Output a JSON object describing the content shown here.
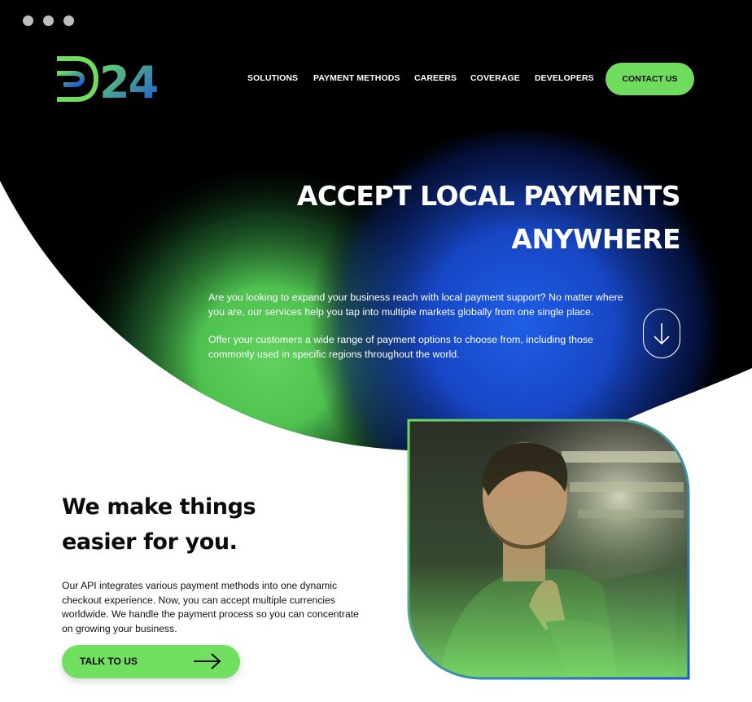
{
  "brand": {
    "logo_text": "D24",
    "colors": {
      "green": "#6fdc5e",
      "blue": "#1a57d6",
      "dark": "#000000"
    }
  },
  "nav": {
    "items": [
      {
        "label": "SOLUTIONS"
      },
      {
        "label": "PAYMENT METHODS"
      },
      {
        "label": "CAREERS"
      },
      {
        "label": "COVERAGE"
      },
      {
        "label": "DEVELOPERS"
      }
    ],
    "contact_label": "CONTACT US"
  },
  "hero": {
    "title_line1": "ACCEPT LOCAL PAYMENTS",
    "title_line2": "ANYWHERE",
    "paragraph1": "Are you looking to expand your business reach with local payment support? No matter where you are, our services help you tap into multiple markets globally from one single place.",
    "paragraph2": "Offer your customers a wide range of payment options to choose from, including those commonly used in specific regions throughout the world.",
    "scroll_icon": "arrow-down-icon"
  },
  "section": {
    "title_line1": "We make things",
    "title_line2": "easier for you.",
    "text": "Our API integrates various payment methods into one dynamic checkout experience. Now, you can accept multiple currencies worldwide.  We handle the payment process so you can concentrate on growing your business.",
    "cta_label": "TALK TO US",
    "cta_icon": "arrow-right-icon"
  }
}
